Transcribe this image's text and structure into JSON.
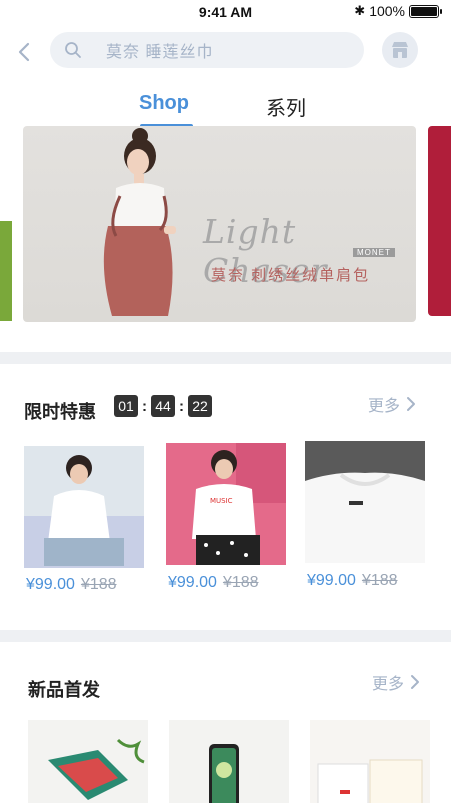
{
  "status_bar": {
    "time": "9:41 AM",
    "battery_text": "100%"
  },
  "search": {
    "placeholder": "莫奈  睡莲丝巾"
  },
  "tabs": [
    {
      "label": "Shop",
      "active": true
    },
    {
      "label": "系列",
      "active": false
    }
  ],
  "banner": {
    "headline": "Light Chaser",
    "brand": "MONET",
    "caption": "莫奈  刺绣丝绒单肩包"
  },
  "flash_sale": {
    "title": "限时特惠",
    "countdown": [
      "01",
      "44",
      "22"
    ],
    "more_label": "更多",
    "products": [
      {
        "price": "¥99.00",
        "original_price": "¥188"
      },
      {
        "price": "¥99.00",
        "original_price": "¥188"
      },
      {
        "price": "¥99.00",
        "original_price": "¥188"
      }
    ]
  },
  "new_arrivals": {
    "title": "新品首发",
    "more_label": "更多"
  },
  "colors": {
    "accent": "#4a90d9",
    "muted": "#a6b4c8",
    "divider": "#eef0f3"
  }
}
